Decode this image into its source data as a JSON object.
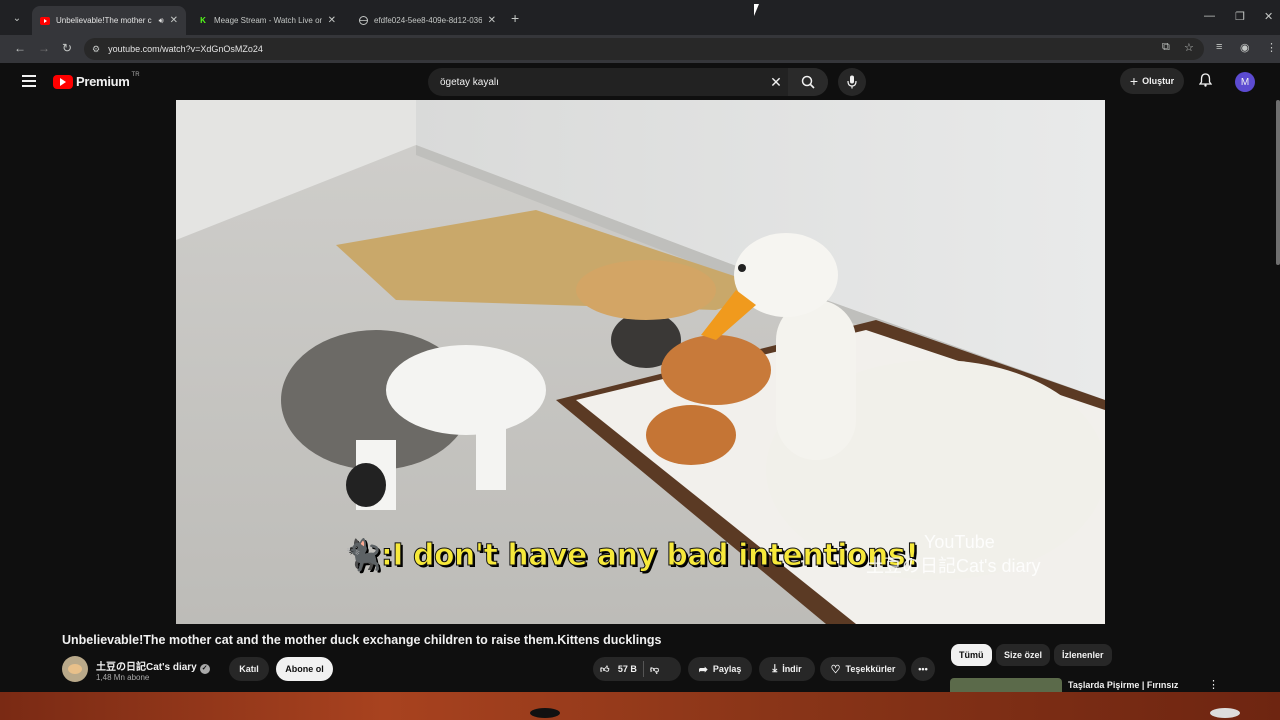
{
  "browser": {
    "tabs": [
      {
        "title": "Unbelievable!The mother c",
        "favicon": "youtube-icon",
        "active": true,
        "audio": true
      },
      {
        "title": "Meage Stream - Watch Live on",
        "favicon": "kick-icon",
        "active": false
      },
      {
        "title": "efdfe024-5ee8-409e-8d12-036",
        "favicon": "globe-icon",
        "active": false
      }
    ],
    "url": "youtube.com/watch?v=XdGnOsMZo24"
  },
  "header": {
    "logo_text": "Premium",
    "country": "TR",
    "search_query": "ögetay kayalı",
    "create_label": "Oluştur",
    "avatar_letter": "M"
  },
  "video": {
    "subtitle": ":I don't have any bad intentions!",
    "watermark_line1": "YouTube",
    "watermark_line2": "土豆の日記Cat's diary",
    "title": "Unbelievable!The mother cat and the mother duck exchange children to raise them.Kittens ducklings"
  },
  "channel": {
    "name": "土豆の日記Cat's diary",
    "subscribers": "1,48 Mn abone",
    "join_label": "Katıl",
    "subscribe_label": "Abone ol"
  },
  "actions": {
    "likes": "57 B",
    "share_label": "Paylaş",
    "download_label": "İndir",
    "thanks_label": "Teşekkürler"
  },
  "sidebar": {
    "chips": [
      "Tümü",
      "Size özel",
      "İzlenenler"
    ],
    "recommendation_title": "Taşlarda Pişirme | Fırınsız"
  },
  "colors": {
    "brand_red": "#ff0000",
    "subtitle_yellow": "#f7e93a",
    "background": "#0f0f0f"
  }
}
